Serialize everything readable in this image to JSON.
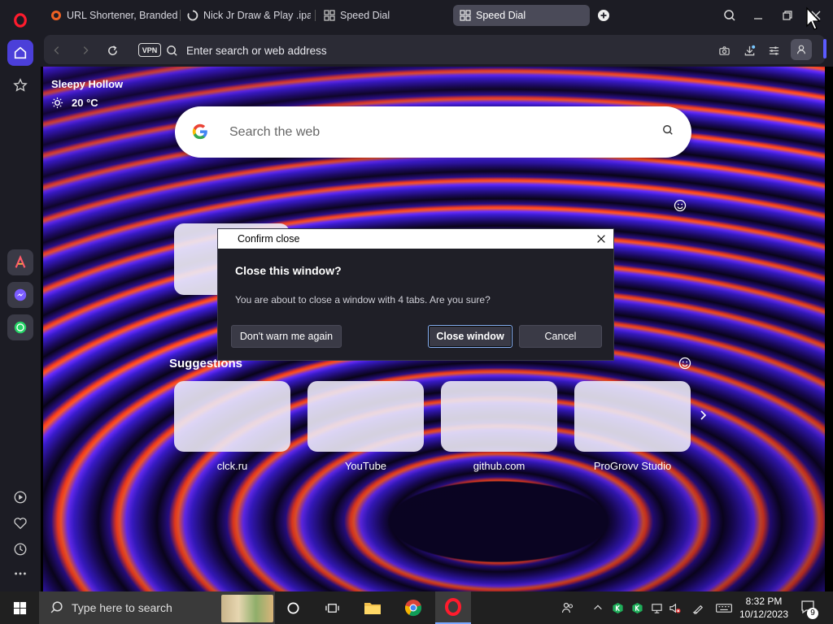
{
  "browser": {
    "tabs": [
      {
        "title": "URL Shortener, Branded S",
        "icon": "bitly-icon",
        "active": false
      },
      {
        "title": "Nick Jr Draw & Play .ipa fi",
        "icon": "loading-icon",
        "active": false
      },
      {
        "title": "Speed Dial",
        "icon": "speed-dial-icon",
        "active": false
      },
      {
        "title": "Speed Dial",
        "icon": "speed-dial-icon",
        "active": true
      }
    ],
    "address": {
      "vpn_label": "VPN",
      "placeholder": "Enter search or web address"
    }
  },
  "speed_dial": {
    "weather": {
      "city": "Sleepy Hollow",
      "temperature": "20 °C"
    },
    "search": {
      "placeholder": "Search the web"
    },
    "suggestions_title": "Suggestions",
    "suggestions": [
      {
        "label": "clck.ru"
      },
      {
        "label": "YouTube"
      },
      {
        "label": "github.com"
      },
      {
        "label": "ProGrovv Studio"
      }
    ]
  },
  "dialog": {
    "title": "Confirm close",
    "heading": "Close this window?",
    "message": "You are about to close a window with 4 tabs. Are you sure?",
    "buttons": {
      "dont_warn": "Don't warn me again",
      "close_window": "Close window",
      "cancel": "Cancel"
    }
  },
  "taskbar": {
    "search_placeholder": "Type here to search",
    "clock_time": "8:32 PM",
    "clock_date": "10/12/2023",
    "notification_count": "9"
  },
  "colors": {
    "accent": "#5b5bff",
    "opera_red": "#ff1b2d",
    "dialog_bg": "#1f1f27"
  }
}
